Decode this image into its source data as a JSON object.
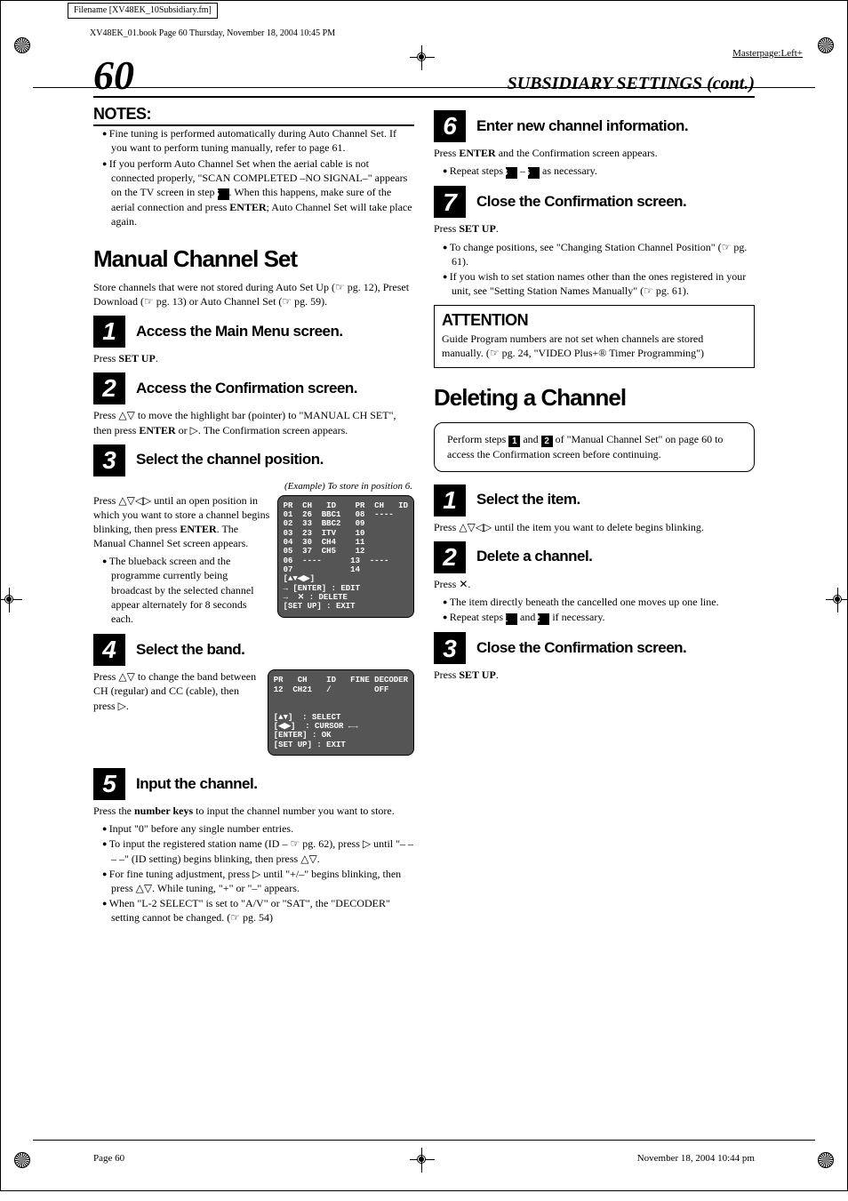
{
  "meta": {
    "filename": "Filename [XV48EK_10Subsidiary.fm]",
    "book": "XV48EK_01.book  Page 60  Thursday, November 18, 2004  10:45 PM",
    "masterpage": "Masterpage:Left+"
  },
  "header": {
    "page_num": "60",
    "section": "SUBSIDIARY SETTINGS (cont.)"
  },
  "left": {
    "notes_heading": "NOTES:",
    "notes": [
      "Fine tuning is performed automatically during Auto Channel Set. If you want to perform tuning manually, refer to page 61.",
      "If you perform Auto Channel Set when the aerial cable is not connected properly, \"SCAN COMPLETED –NO SIGNAL–\" appears on the TV screen in step 5. When this happens, make sure of the aerial connection and press ENTER; Auto Channel Set will take place again."
    ],
    "title1": "Manual Channel Set",
    "intro": "Store channels that were not stored during Auto Set Up (☞ pg. 12), Preset Download (☞ pg. 13) or Auto Channel Set (☞ pg. 59).",
    "steps": {
      "s1": {
        "title": "Access the Main Menu screen.",
        "body": "Press SET UP."
      },
      "s2": {
        "title": "Access the Confirmation screen.",
        "body": "Press △▽ to move the highlight bar (pointer) to \"MANUAL CH SET\", then press ENTER or ▷. The Confirmation screen appears."
      },
      "s3": {
        "title": "Select the channel position.",
        "caption": "(Example) To store in position 6.",
        "body": "Press △▽◁▷ until an open position in which you want to store a channel begins blinking, then press ENTER. The Manual Channel Set screen appears.",
        "bullet": "The blueback screen and the programme currently being broadcast by the selected channel appear alternately for 8 seconds each."
      },
      "s4": {
        "title": "Select the band.",
        "body": "Press △▽ to change the band between CH (regular) and CC (cable), then press ▷."
      },
      "s5": {
        "title": "Input the channel.",
        "body": "Press the number keys to input the channel number you want to store.",
        "bullets": [
          "Input \"0\" before any single number entries.",
          "To input the registered station name (ID – ☞ pg. 62), press ▷ until \"– – – –\" (ID setting) begins blinking, then press △▽.",
          "For fine tuning adjustment, press ▷ until \"+/–\" begins blinking, then press △▽. While tuning, \"+\" or \"–\" appears.",
          "When \"L-2 SELECT\" is set to \"A/V\" or \"SAT\", the \"DECODER\" setting cannot be changed. (☞ pg. 54)"
        ]
      }
    },
    "osd1": "PR  CH   ID    PR  CH   ID\n01  26  BBC1   08  ----\n02  33  BBC2   09\n03  23  ITV    10\n04  30  CH4    11\n05  37  CH5    12\n06  ----      13  ----\n07            14\n[▲▼◀▶]\n→ [ENTER] : EDIT\n→  ✕ : DELETE\n[SET UP] : EXIT",
    "osd2": "PR   CH    ID   FINE DECODER\n12  CH21   /         OFF\n\n\n[▲▼]  : SELECT\n[◀▶]  : CURSOR ←→\n[ENTER] : OK\n[SET UP] : EXIT"
  },
  "right": {
    "steps": {
      "s6": {
        "title": "Enter new channel information.",
        "body": "Press ENTER and the Confirmation screen appears.",
        "bullet": "Repeat steps 3 – 6 as necessary."
      },
      "s7": {
        "title": "Close the Confirmation screen.",
        "body": "Press SET UP.",
        "bullets": [
          "To change positions, see \"Changing Station Channel Position\" (☞ pg. 61).",
          "If you wish to set station names other than the ones registered in your unit, see \"Setting Station Names Manually\" (☞ pg. 61)."
        ]
      }
    },
    "attention_heading": "ATTENTION",
    "attention_body": "Guide Program numbers are not set when channels are stored manually. (☞ pg. 24, \"VIDEO Plus+® Timer Programming\")",
    "title2": "Deleting a Channel",
    "perform": "Perform steps 1 and 2 of \"Manual Channel Set\" on page 60 to access the Confirmation screen before continuing.",
    "del": {
      "s1": {
        "title": "Select the item.",
        "body": "Press △▽◁▷ until the item you want to delete begins blinking."
      },
      "s2": {
        "title": "Delete a channel.",
        "body": "Press ✕.",
        "bullets": [
          "The item directly beneath the cancelled one moves up one line.",
          "Repeat steps 1 and 2 if necessary."
        ]
      },
      "s3": {
        "title": "Close the Confirmation screen.",
        "body": "Press SET UP."
      }
    }
  },
  "footer": {
    "left": "Page 60",
    "right": "November 18, 2004 10:44 pm"
  }
}
